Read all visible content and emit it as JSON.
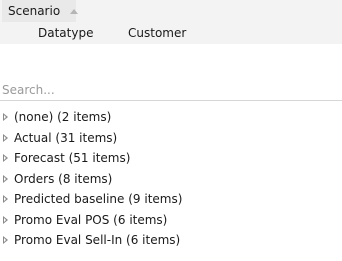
{
  "header": {
    "group_field": "Scenario",
    "columns": [
      "Datatype",
      "Customer"
    ]
  },
  "search": {
    "placeholder": "Search...",
    "value": ""
  },
  "items": [
    {
      "label": "(none) (2 items)"
    },
    {
      "label": "Actual (31 items)"
    },
    {
      "label": "Forecast (51 items)"
    },
    {
      "label": "Orders (8 items)"
    },
    {
      "label": "Predicted baseline (9 items)"
    },
    {
      "label": "Promo Eval POS (6 items)"
    },
    {
      "label": "Promo Eval Sell-In (6 items)"
    }
  ]
}
